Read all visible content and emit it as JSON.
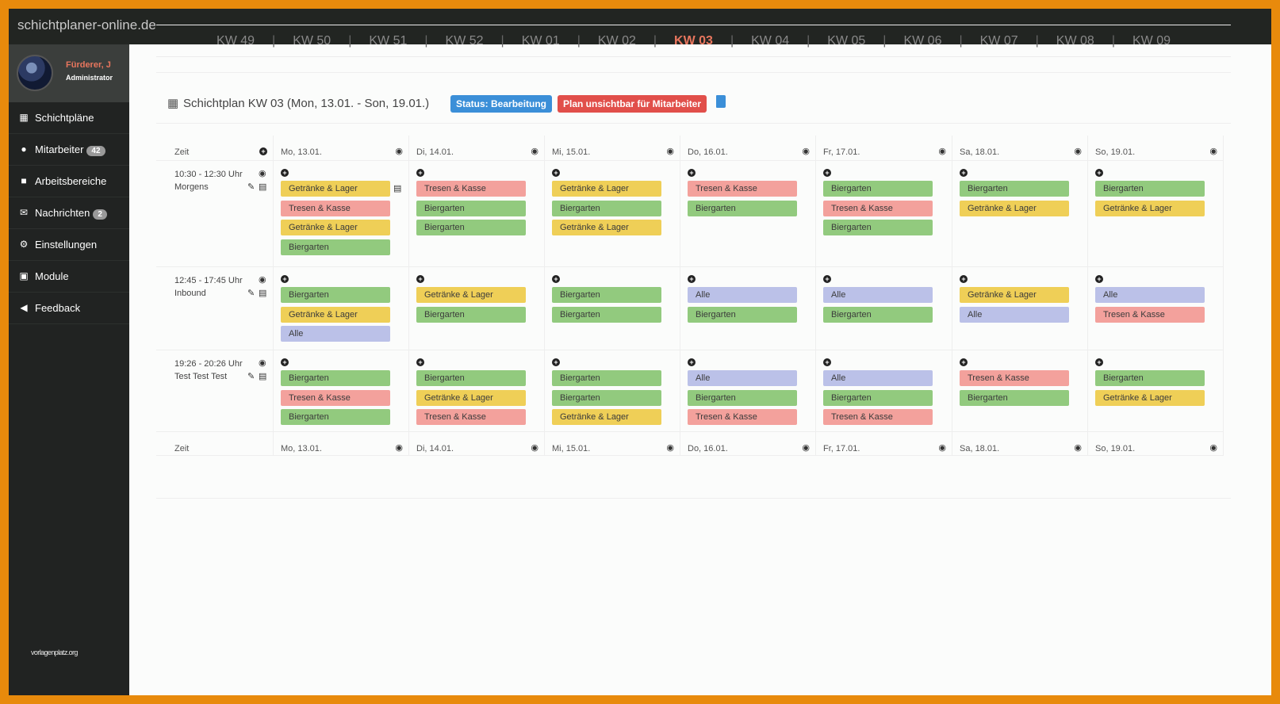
{
  "app": {
    "title": "schichtplaner-online.de"
  },
  "user": {
    "name": "Fürderer, J",
    "role": "Administrator"
  },
  "nav": [
    {
      "label": "Schichtpläne",
      "icon": "calendar-icon",
      "badge": ""
    },
    {
      "label": "Mitarbeiter",
      "icon": "user-icon",
      "badge": "42"
    },
    {
      "label": "Arbeitsbereiche",
      "icon": "briefcase-icon",
      "badge": ""
    },
    {
      "label": "Nachrichten",
      "icon": "envelope-icon",
      "badge": "2"
    },
    {
      "label": "Einstellungen",
      "icon": "gear-icon",
      "badge": ""
    },
    {
      "label": "Module",
      "icon": "grid-icon",
      "badge": ""
    },
    {
      "label": "Feedback",
      "icon": "megaphone-icon",
      "badge": ""
    }
  ],
  "footer_logo": "vorlagenplatz.org",
  "weeks": [
    "KW 49",
    "KW 50",
    "KW 51",
    "KW 52",
    "KW 01",
    "KW 02",
    "KW 03",
    "KW 04",
    "KW 05",
    "KW 06",
    "KW 07",
    "KW 08",
    "KW 09"
  ],
  "active_week": "KW 03",
  "plan": {
    "title": "Schichtplan KW 03 (Mon, 13.01. - Son, 19.01.)",
    "status": "Status: Bearbeitung",
    "visibility": "Plan unsichtbar für Mitarbeiter"
  },
  "time_header": "Zeit",
  "days": [
    "Mo, 13.01.",
    "Di, 14.01.",
    "Mi, 15.01.",
    "Do, 16.01.",
    "Fr, 17.01.",
    "Sa, 18.01.",
    "So, 19.01."
  ],
  "colors": {
    "Getränke & Lager": "#efcf57",
    "Tresen & Kasse": "#f3a19c",
    "Biergarten": "#92ca7e",
    "Alle": "#bbc1e8"
  },
  "shifts": [
    {
      "time": "10:30 - 12:30 Uhr",
      "name": "Morgens",
      "days": [
        [
          "Getränke & Lager",
          "Tresen & Kasse",
          "Getränke & Lager",
          "Biergarten"
        ],
        [
          "Tresen & Kasse",
          "Biergarten",
          "Biergarten"
        ],
        [
          "Getränke & Lager",
          "Biergarten",
          "Getränke & Lager"
        ],
        [
          "Tresen & Kasse",
          "Biergarten"
        ],
        [
          "Biergarten",
          "Tresen & Kasse",
          "Biergarten"
        ],
        [
          "Biergarten",
          "Getränke & Lager"
        ],
        [
          "Biergarten",
          "Getränke & Lager"
        ]
      ]
    },
    {
      "time": "12:45 - 17:45 Uhr",
      "name": "Inbound",
      "days": [
        [
          "Biergarten",
          "Getränke & Lager",
          "Alle"
        ],
        [
          "Getränke & Lager",
          "Biergarten"
        ],
        [
          "Biergarten",
          "Biergarten"
        ],
        [
          "Alle",
          "Biergarten"
        ],
        [
          "Alle",
          "Biergarten"
        ],
        [
          "Getränke & Lager",
          "Alle"
        ],
        [
          "Alle",
          "Tresen & Kasse"
        ]
      ]
    },
    {
      "time": "19:26 - 20:26 Uhr",
      "name": "Test Test Test",
      "days": [
        [
          "Biergarten",
          "Tresen & Kasse",
          "Biergarten"
        ],
        [
          "Biergarten",
          "Getränke & Lager",
          "Tresen & Kasse"
        ],
        [
          "Biergarten",
          "Biergarten",
          "Getränke & Lager"
        ],
        [
          "Alle",
          "Biergarten",
          "Tresen & Kasse"
        ],
        [
          "Alle",
          "Biergarten",
          "Tresen & Kasse"
        ],
        [
          "Tresen & Kasse",
          "Biergarten"
        ],
        [
          "Biergarten",
          "Getränke & Lager"
        ]
      ]
    }
  ]
}
